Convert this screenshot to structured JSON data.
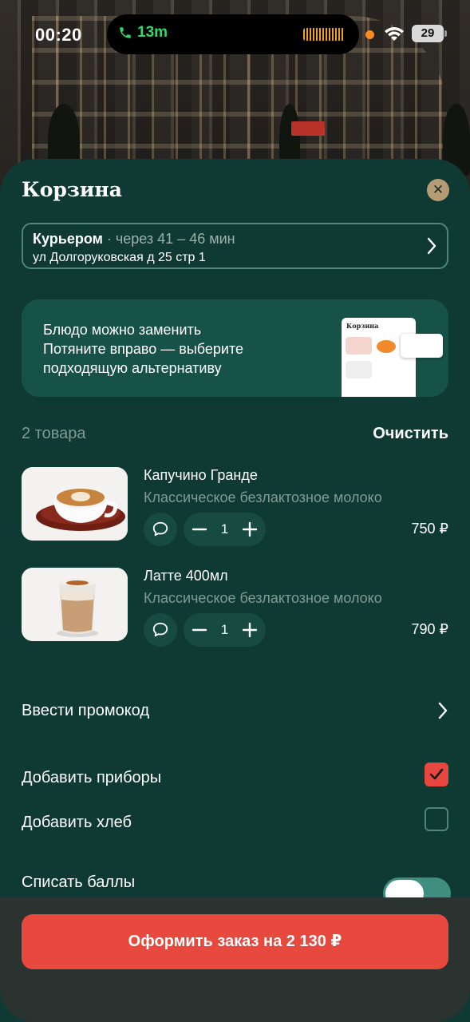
{
  "status_bar": {
    "time": "00:20",
    "call_duration": "13m",
    "battery": "29"
  },
  "cart": {
    "title": "Корзина",
    "delivery": {
      "method": "Курьером",
      "separator": " · ",
      "eta": "через 41 – 46 мин",
      "address": "ул Долгоруковская д 25 стр 1"
    },
    "banner": {
      "title": "Блюдо можно заменить",
      "text_line1": "Потяните вправо — выберите",
      "text_line2": "подходящую альтернативу",
      "preview_title": "Корзина"
    },
    "items_count": "2 товара",
    "clear_label": "Очистить",
    "items": [
      {
        "name": "Капучино Гранде",
        "description": "Классическое безлактозное молоко",
        "quantity": "1",
        "price": "750 ₽"
      },
      {
        "name": "Латте 400мл",
        "description": "Классическое безлактозное молоко",
        "quantity": "1",
        "price": "790 ₽"
      }
    ],
    "promo_label": "Ввести промокод",
    "options": {
      "cutlery_label": "Добавить приборы",
      "cutlery_checked": true,
      "bread_label": "Добавить хлеб",
      "bread_checked": false,
      "points_label": "Списать баллы",
      "points_enabled": true
    },
    "checkout_label": "Оформить заказ на 2 130 ₽"
  },
  "colors": {
    "sheet_bg": "#0f3a33",
    "accent_red": "#e8493f",
    "muted_text": "#7f9c94"
  }
}
